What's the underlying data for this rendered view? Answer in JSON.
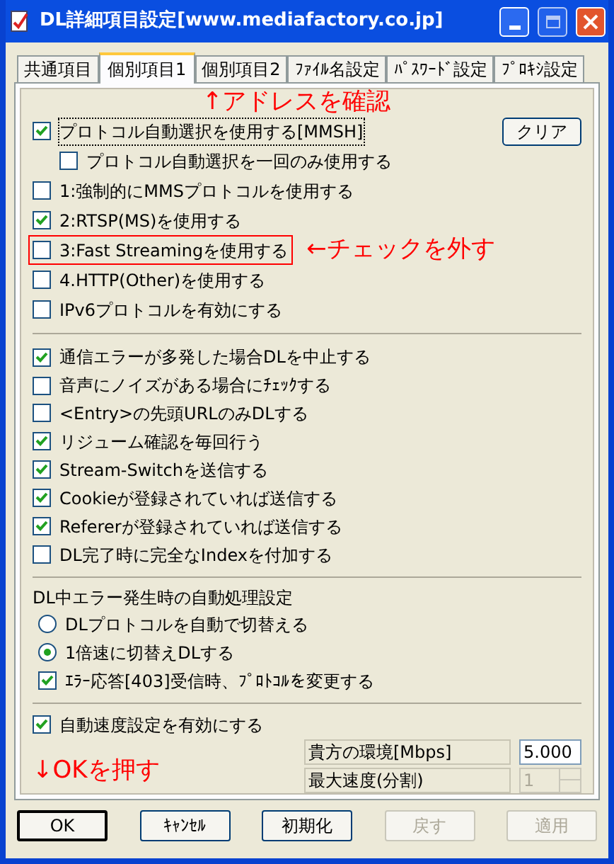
{
  "window": {
    "title": "DL詳細項目設定[www.mediafactory.co.jp]"
  },
  "tabs": [
    {
      "label": "共通項目",
      "selected": false
    },
    {
      "label": "個別項目1",
      "selected": true
    },
    {
      "label": "個別項目2",
      "selected": false
    },
    {
      "label": "ﾌｧｲﾙ名設定",
      "selected": false
    },
    {
      "label": "ﾊﾟｽﾜｰﾄﾞ設定",
      "selected": false
    },
    {
      "label": "ﾌﾟﾛｷｼ設定",
      "selected": false
    }
  ],
  "note_top": "↑アドレスを確認",
  "protocol": {
    "clear_button": "クリア",
    "items": [
      {
        "label": "プロトコル自動選択を使用する[MMSH]",
        "checked": true,
        "focused": true,
        "highlighted": false,
        "children": [
          {
            "label": "プロトコル自動選択を一回のみ使用する",
            "checked": false
          }
        ]
      },
      {
        "label": "1:強制的にMMSプロトコルを使用する",
        "checked": false,
        "focused": false,
        "highlighted": false
      },
      {
        "label": "2:RTSP(MS)を使用する",
        "checked": true,
        "focused": false,
        "highlighted": false
      },
      {
        "label": "3:Fast Streamingを使用する",
        "checked": false,
        "focused": false,
        "highlighted": true,
        "note": "←チェックを外す"
      },
      {
        "label": "4.HTTP(Other)を使用する",
        "checked": false,
        "focused": false,
        "highlighted": false
      },
      {
        "label": "IPv6プロトコルを有効にする",
        "checked": false,
        "focused": false,
        "highlighted": false
      }
    ]
  },
  "options": [
    {
      "label": "通信エラーが多発した場合DLを中止する",
      "checked": true
    },
    {
      "label": "音声にノイズがある場合にﾁｪｯｸする",
      "checked": false
    },
    {
      "label": "<Entry>の先頭URLのみDLする",
      "checked": false
    },
    {
      "label": "リジューム確認を毎回行う",
      "checked": true
    },
    {
      "label": "Stream-Switchを送信する",
      "checked": true
    },
    {
      "label": "Cookieが登録されていれば送信する",
      "checked": true
    },
    {
      "label": "Refererが登録されていれば送信する",
      "checked": true
    },
    {
      "label": "DL完了時に完全なIndexを付加する",
      "checked": false
    }
  ],
  "error_handling": {
    "title": "DL中エラー発生時の自動処理設定",
    "items": [
      {
        "kind": "radio",
        "label": "DLプロトコルを自動で切替える",
        "selected": false
      },
      {
        "kind": "radio",
        "label": "1倍速に切替えDLする",
        "selected": true
      },
      {
        "kind": "checkbox",
        "label": "ｴﾗｰ応答[403]受信時、ﾌﾟﾛﾄｺﾙを変更する",
        "checked": true
      }
    ]
  },
  "speed": {
    "label": "自動速度設定を有効にする",
    "checked": true,
    "fields": [
      {
        "kind": "text",
        "label": "貴方の環境[Mbps]",
        "value": "5.000",
        "disabled": false
      },
      {
        "kind": "spin",
        "label": "最大速度(分割)",
        "value": "1",
        "disabled": true
      }
    ],
    "note": "↓OKを押す"
  },
  "buttons": [
    {
      "label": "OK",
      "default": true,
      "disabled": false
    },
    {
      "label": "ｷｬﾝｾﾙ",
      "default": false,
      "disabled": false
    },
    {
      "label": "初期化",
      "default": false,
      "disabled": false
    },
    {
      "label": "戻す",
      "default": false,
      "disabled": true
    },
    {
      "label": "適用",
      "default": false,
      "disabled": true
    }
  ]
}
